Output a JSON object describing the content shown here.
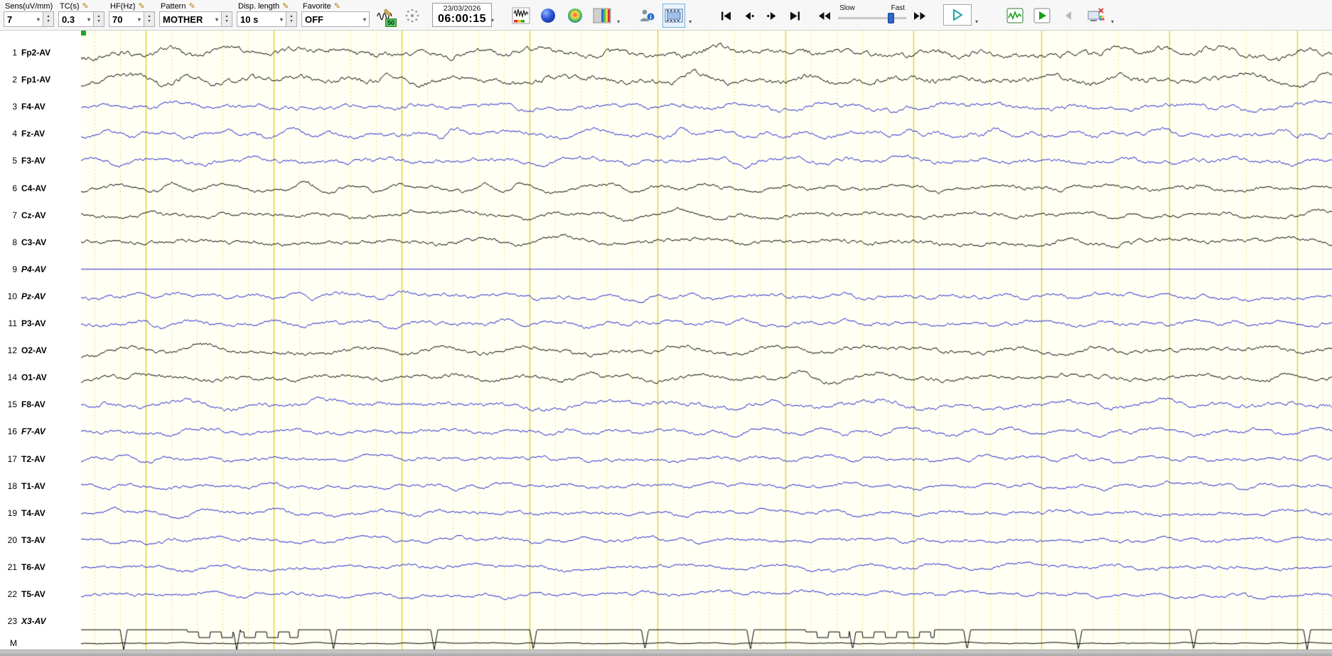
{
  "icons": {
    "dropdown_arrow": "▾",
    "spinner_up": "▴",
    "spinner_down": "▾",
    "pencil": "✎"
  },
  "toolbar": {
    "sens": {
      "label": "Sens(uV/mm)",
      "value": "7"
    },
    "tc": {
      "label": "TC(s)",
      "value": "0.3"
    },
    "hf": {
      "label": "HF(Hz)",
      "value": "70"
    },
    "pattern": {
      "label": "Pattern",
      "value": "MOTHER"
    },
    "disp_length": {
      "label": "Disp. length",
      "value": "10 s"
    },
    "favorite": {
      "label": "Favorite",
      "value": "OFF"
    },
    "notch_badge": "50",
    "date": "23/03/2026",
    "time": "06:00:15",
    "speed": {
      "slow": "Slow",
      "fast": "Fast",
      "position": 0.78
    }
  },
  "colors": {
    "trace_black": "#000000",
    "trace_blue": "#2222cc",
    "paper_bg": "#fffff4",
    "grid_major": "#ded32e",
    "grid_minor": "#ebe482",
    "accent_play": "#2aa7a7",
    "slider_thumb": "#2f66c9",
    "marker_green": "#1ea21e"
  },
  "channels": [
    {
      "num": "1",
      "label": "Fp2-AV",
      "color": "black",
      "italic": false,
      "type": "eeg",
      "amp": 12,
      "seed": 101
    },
    {
      "num": "2",
      "label": "Fp1-AV",
      "color": "black",
      "italic": false,
      "type": "eeg",
      "amp": 12,
      "seed": 102
    },
    {
      "num": "3",
      "label": "F4-AV",
      "color": "blue",
      "italic": false,
      "type": "eeg",
      "amp": 9,
      "seed": 103
    },
    {
      "num": "4",
      "label": "Fz-AV",
      "color": "blue",
      "italic": false,
      "type": "eeg",
      "amp": 9,
      "seed": 104
    },
    {
      "num": "5",
      "label": "F3-AV",
      "color": "blue",
      "italic": false,
      "type": "eeg",
      "amp": 9,
      "seed": 105
    },
    {
      "num": "6",
      "label": "C4-AV",
      "color": "black",
      "italic": false,
      "type": "eeg",
      "amp": 8,
      "seed": 106
    },
    {
      "num": "7",
      "label": "Cz-AV",
      "color": "black",
      "italic": false,
      "type": "eeg",
      "amp": 8,
      "seed": 107
    },
    {
      "num": "8",
      "label": "C3-AV",
      "color": "black",
      "italic": false,
      "type": "eeg",
      "amp": 9,
      "seed": 108
    },
    {
      "num": "9",
      "label": "P4-AV",
      "color": "blue",
      "italic": true,
      "type": "flat",
      "amp": 0,
      "seed": 109
    },
    {
      "num": "10",
      "label": "Pz-AV",
      "color": "blue",
      "italic": true,
      "type": "eeg",
      "amp": 8,
      "seed": 110
    },
    {
      "num": "11",
      "label": "P3-AV",
      "color": "blue",
      "italic": false,
      "type": "eeg",
      "amp": 8,
      "seed": 111
    },
    {
      "num": "12",
      "label": "O2-AV",
      "color": "black",
      "italic": false,
      "type": "eeg",
      "amp": 9,
      "seed": 112
    },
    {
      "num": "14",
      "label": "O1-AV",
      "color": "black",
      "italic": false,
      "type": "eeg",
      "amp": 9,
      "seed": 113
    },
    {
      "num": "15",
      "label": "F8-AV",
      "color": "blue",
      "italic": false,
      "type": "eeg",
      "amp": 10,
      "seed": 114
    },
    {
      "num": "16",
      "label": "F7-AV",
      "color": "blue",
      "italic": true,
      "type": "eeg",
      "amp": 8,
      "seed": 115
    },
    {
      "num": "17",
      "label": "T2-AV",
      "color": "blue",
      "italic": false,
      "type": "eeg",
      "amp": 7,
      "seed": 116
    },
    {
      "num": "18",
      "label": "T1-AV",
      "color": "blue",
      "italic": false,
      "type": "eeg",
      "amp": 7,
      "seed": 117
    },
    {
      "num": "19",
      "label": "T4-AV",
      "color": "blue",
      "italic": false,
      "type": "eeg",
      "amp": 7,
      "seed": 118
    },
    {
      "num": "20",
      "label": "T3-AV",
      "color": "blue",
      "italic": false,
      "type": "eeg",
      "amp": 7,
      "seed": 119
    },
    {
      "num": "21",
      "label": "T6-AV",
      "color": "blue",
      "italic": false,
      "type": "eeg",
      "amp": 7,
      "seed": 120
    },
    {
      "num": "22",
      "label": "T5-AV",
      "color": "blue",
      "italic": false,
      "type": "eeg",
      "amp": 7,
      "seed": 121
    },
    {
      "num": "23",
      "label": "X3-AV",
      "color": "black",
      "italic": true,
      "type": "event",
      "amp": 0,
      "seed": 122
    },
    {
      "num": "M",
      "label": "",
      "color": "black",
      "italic": false,
      "type": "eeg",
      "amp": 1.5,
      "seed": 123
    }
  ]
}
